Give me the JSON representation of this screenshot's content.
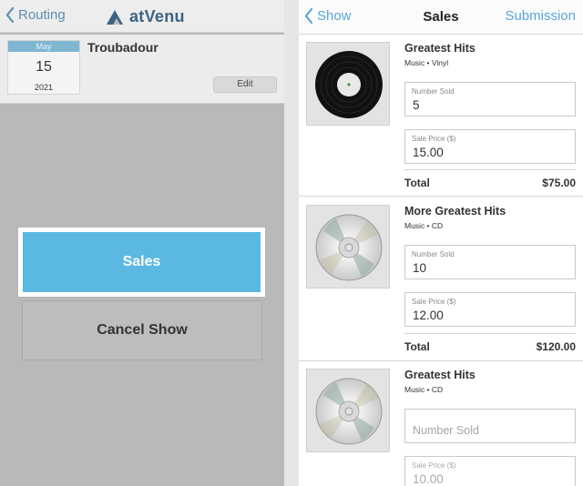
{
  "left_panel": {
    "nav": {
      "back_label": "Routing",
      "logo_text": "atVenu",
      "back_icon": "chevron-left-icon",
      "logo_icon": "atvenu-logo-icon"
    },
    "show": {
      "month": "May",
      "day": "15",
      "year": "2021",
      "venue": "Troubadour",
      "edit_label": "Edit"
    },
    "actions": {
      "sales_label": "Sales",
      "cancel_label": "Cancel Show"
    },
    "colors": {
      "accent": "#5bb8e0",
      "overlay": "#b9b9b9"
    }
  },
  "right_panel": {
    "nav": {
      "back_label": "Show",
      "title": "Sales",
      "submission_label": "Submission",
      "back_icon": "chevron-left-icon"
    },
    "items": [
      {
        "name": "Greatest Hits",
        "category": "Music • Vinyl",
        "icon": "vinyl-record-icon",
        "number_sold_label": "Number Sold",
        "number_sold": "5",
        "price_label": "Sale Price ($)",
        "price": "15.00",
        "total_label": "Total",
        "total": "$75.00"
      },
      {
        "name": "More Greatest Hits",
        "category": "Music • CD",
        "icon": "cd-icon",
        "number_sold_label": "Number Sold",
        "number_sold": "10",
        "price_label": "Sale Price ($)",
        "price": "12.00",
        "total_label": "Total",
        "total": "$120.00"
      },
      {
        "name": "Greatest Hits",
        "category": "Music • CD",
        "icon": "cd-icon",
        "number_sold_placeholder": "Number Sold",
        "price_label": "Sale Price ($)",
        "price": "10.00"
      }
    ],
    "colors": {
      "link": "#58a7d8"
    }
  }
}
